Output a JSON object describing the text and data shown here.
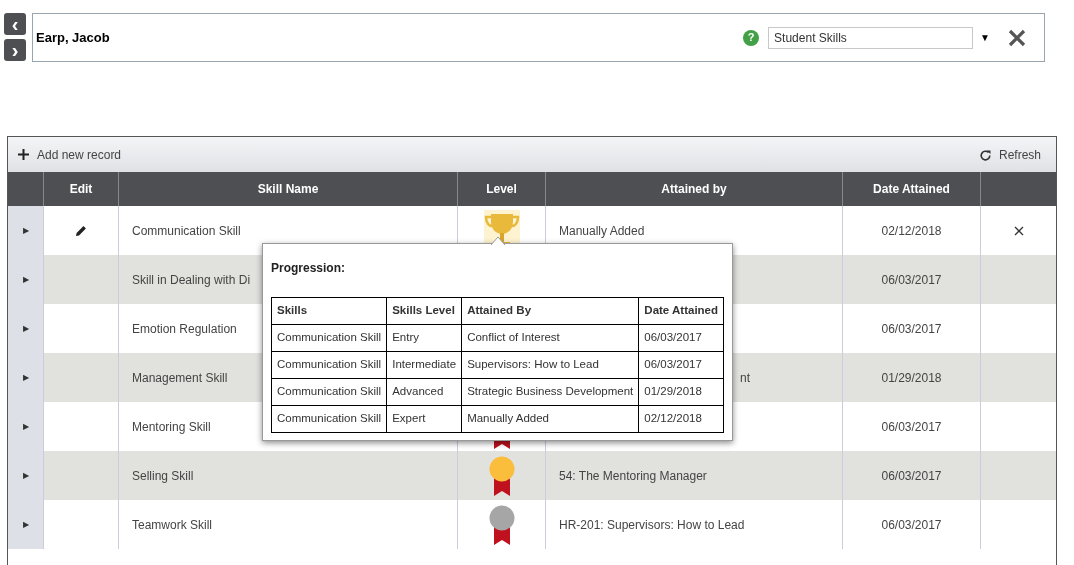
{
  "nav": {
    "prev": "‹",
    "next": "›"
  },
  "header": {
    "name": "Earp, Jacob",
    "help": "?",
    "select": {
      "value": "Student Skills"
    },
    "caret": "▼"
  },
  "toolbar": {
    "add": "Add new record",
    "refresh": "Refresh"
  },
  "table": {
    "columns": [
      "Edit",
      "Skill Name",
      "Level",
      "Attained by",
      "Date Attained"
    ],
    "rows": [
      {
        "arrow": "▶",
        "skill": "Communication Skill",
        "kind": "trophy",
        "attained_by": "Manually Added",
        "date": "02/12/2018",
        "editable": true,
        "shifted": false
      },
      {
        "arrow": "▶",
        "kind": "plain",
        "skill": "Skill in Dealing with Di",
        "date": "06/03/2017",
        "editable": false
      },
      {
        "arrow": "▶",
        "kind": "plain",
        "skill": "Emotion Regulation",
        "date": "06/03/2017",
        "editable": false
      },
      {
        "arrow": "▶",
        "kind": "plain",
        "skill": "Management Skill",
        "attained_by": "nt",
        "date": "01/29/2018",
        "editable": false,
        "shifted": true
      },
      {
        "arrow": "▶",
        "skill": "Mentoring Skill",
        "kind": "ribbon",
        "date": "06/03/2017",
        "editable": false
      },
      {
        "arrow": "▶",
        "skill": "Selling Skill",
        "kind": "medal",
        "color": "#fbbd3c",
        "attained_by": "54: The Mentoring Manager",
        "date": "06/03/2017",
        "editable": false,
        "shifted": false
      },
      {
        "arrow": "▶",
        "skill": "Teamwork Skill",
        "kind": "medal",
        "color": "#a6a6a6",
        "attained_by": "HR-201: Supervisors: How to Lead",
        "date": "06/03/2017",
        "editable": false,
        "shifted": false
      }
    ]
  },
  "popup": {
    "title": "Progression:",
    "columns": [
      "Skills",
      "Skills Level",
      "Attained By",
      "Date Attained"
    ],
    "rows": [
      [
        "Communication Skill",
        "Entry",
        "Conflict of Interest",
        "06/03/2017"
      ],
      [
        "Communication Skill",
        "Intermediate",
        "Supervisors: How to Lead",
        "06/03/2017"
      ],
      [
        "Communication Skill",
        "Advanced",
        "Strategic Business Development",
        "01/29/2018"
      ],
      [
        "Communication Skill",
        "Expert",
        "Manually Added",
        "02/12/2018"
      ]
    ]
  }
}
